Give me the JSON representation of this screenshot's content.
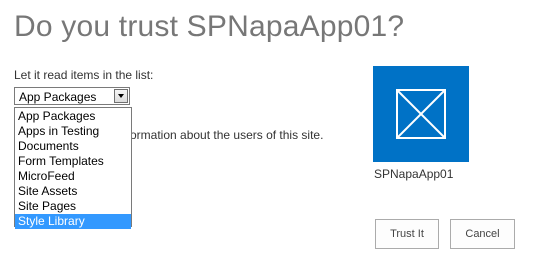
{
  "dialog": {
    "title": "Do you trust SPNapaApp01?",
    "list_permission_label": "Let it read items in the list:",
    "description_visible": "ormation about the users of this site."
  },
  "list_select": {
    "selected": "App Packages",
    "options": [
      "App Packages",
      "Apps in Testing",
      "Documents",
      "Form Templates",
      "MicroFeed",
      "Site Assets",
      "Site Pages",
      "Style Library"
    ],
    "highlighted": "Style Library"
  },
  "app": {
    "name": "SPNapaApp01",
    "icon": "app-placeholder-icon",
    "tile_color": "#0072c6"
  },
  "buttons": {
    "trust": "Trust It",
    "cancel": "Cancel"
  },
  "colors": {
    "title": "#777777",
    "highlight": "#3399ff"
  }
}
